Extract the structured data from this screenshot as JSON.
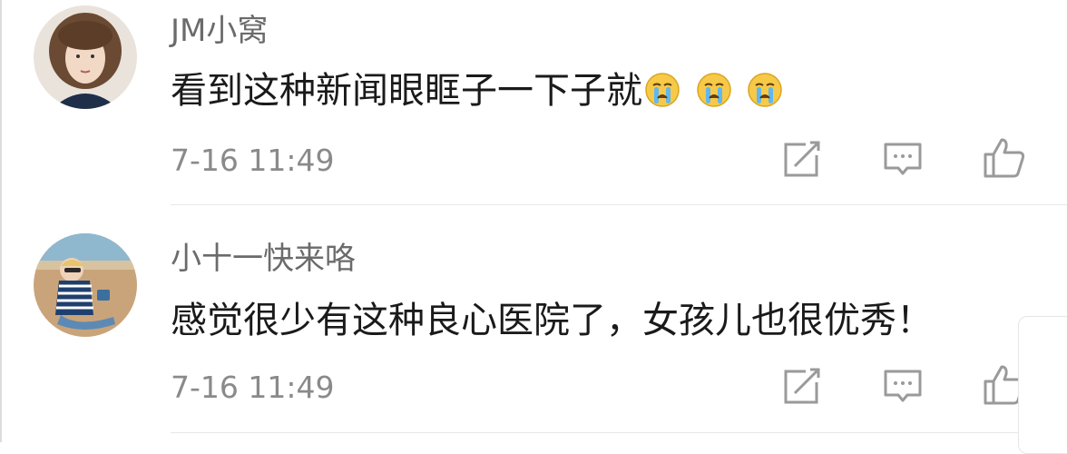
{
  "comments": [
    {
      "username": "JM小窝",
      "text": "看到这种新闻眼眶子一下子就",
      "emojis": [
        "crying-face-emoji",
        "crying-face-emoji",
        "crying-face-emoji"
      ],
      "time": "7-16 11:49",
      "actions": [
        "repost-icon",
        "comment-icon",
        "like-icon"
      ]
    },
    {
      "username": "小十一快来咯",
      "text": "感觉很少有这种良心医院了，女孩儿也很优秀！",
      "time": "7-16 11:49",
      "actions": [
        "repost-icon",
        "comment-icon",
        "like-icon"
      ]
    }
  ]
}
